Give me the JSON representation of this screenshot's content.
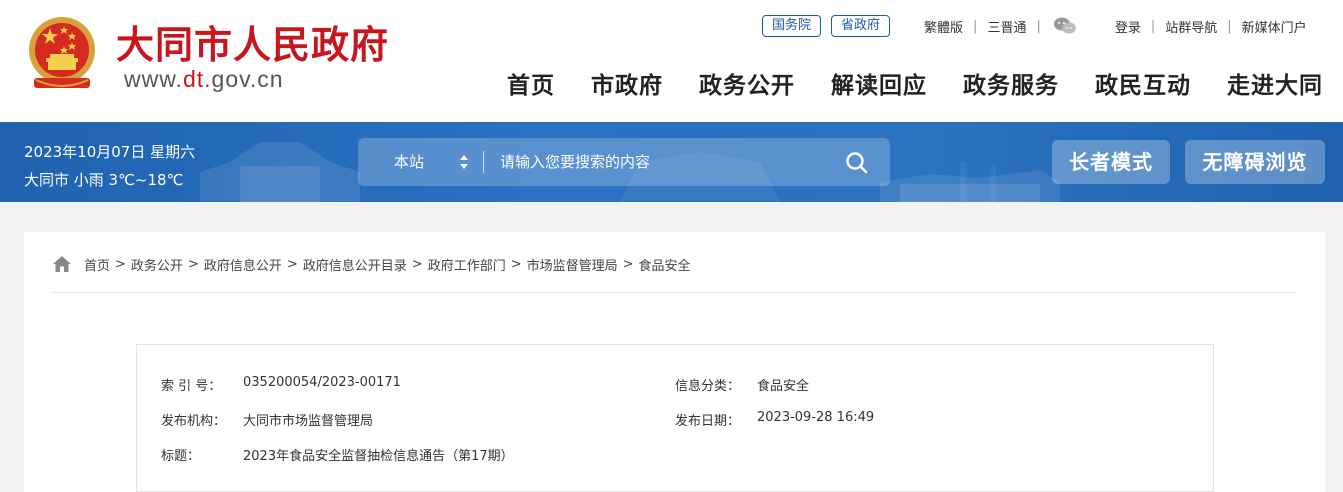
{
  "header": {
    "site_name": "大同市人民政府",
    "url_prefix": "www.",
    "url_highlight": "dt",
    "url_suffix": ".gov.cn",
    "top_links": {
      "guowuyuan": "国务院",
      "shengzhengfu": "省政府",
      "traditional": "繁體版",
      "sanjintong": "三晋通",
      "login": "登录",
      "site_nav": "站群导航",
      "new_media": "新媒体门户"
    },
    "nav": [
      "首页",
      "市政府",
      "政务公开",
      "解读回应",
      "政务服务",
      "政民互动",
      "走进大同"
    ]
  },
  "band": {
    "date": "2023年10月07日 星期六",
    "weather": "大同市 小雨 3℃~18℃",
    "search": {
      "scope": "本站",
      "placeholder": "请输入您要搜索的内容"
    },
    "elder_mode": "长者模式",
    "accessible": "无障碍浏览"
  },
  "breadcrumb": [
    "首页",
    "政务公开",
    "政府信息公开",
    "政府信息公开目录",
    "政府工作部门",
    "市场监督管理局",
    "食品安全"
  ],
  "meta": {
    "index_label": "索 引 号：",
    "index_value": "035200054/2023-00171",
    "category_label": "信息分类：",
    "category_value": "食品安全",
    "publisher_label": "发布机构：",
    "publisher_value": "大同市市场监督管理局",
    "date_label": "发布日期：",
    "date_value": "2023-09-28 16:49",
    "title_label": "标题：",
    "title_value": "2023年食品安全监督抽检信息通告（第17期）"
  },
  "colors": {
    "brand_red": "#c8161d",
    "band_blue": "#2a6fbe",
    "link_blue": "#1f5aa6"
  },
  "icons": [
    "national-emblem-icon",
    "wechat-icon",
    "sort-arrows-icon",
    "search-icon",
    "home-icon"
  ]
}
